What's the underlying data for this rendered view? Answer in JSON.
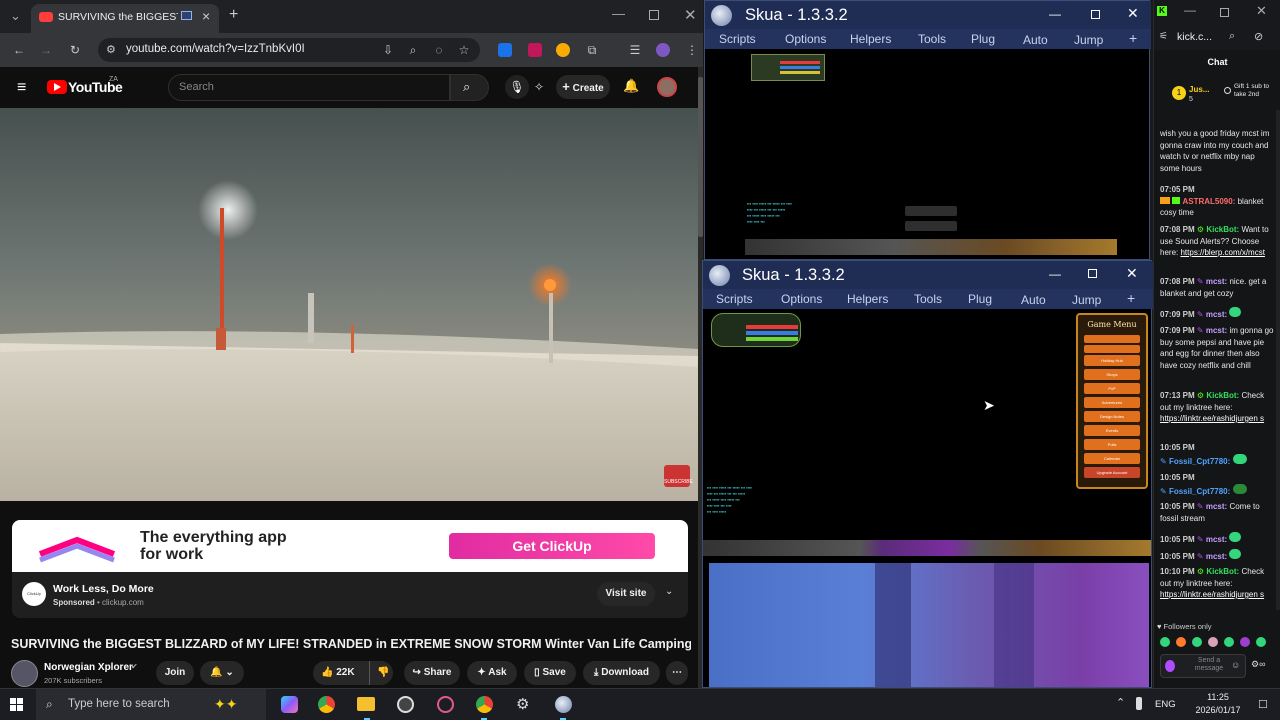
{
  "chrome": {
    "tab_title": "SURVIVING the BIGGEST BL",
    "url": "youtube.com/watch?v=IzzTnbKvI0I",
    "new_tab_label": "+"
  },
  "youtube": {
    "logo_text": "YouTube",
    "logo_region": "ZA",
    "search_placeholder": "Search",
    "create_label": "Create",
    "ad": {
      "banner_text_line1": "The everything app",
      "banner_text_line2": "for work",
      "banner_cta": "Get ClickUp",
      "title": "Work Less, Do More",
      "sponsored": "Sponsored",
      "domain": "clickup.com",
      "visit_label": "Visit site",
      "logo_text": "ClickUp"
    },
    "video_title": "SURVIVING the BIGGEST BLIZZARD of MY LIFE! STRANDED in EXTREME SNOW STORM Winter Van Life Camping",
    "channel_name": "Norwegian Xplorer",
    "subscribers": "207K subscribers",
    "join_label": "Join",
    "likes": "22K",
    "share_label": "Share",
    "ask_label": "Ask",
    "save_label": "Save",
    "download_label": "Download",
    "subscribe_badge": "SUBSCRIBE"
  },
  "skua_top": {
    "title": "Skua - 1.3.3.2",
    "menu": [
      "Scripts",
      "Options",
      "Helpers",
      "Tools",
      "Plug",
      "Auto",
      "Jump",
      "+"
    ]
  },
  "skua_bottom": {
    "title": "Skua - 1.3.3.2",
    "menu": [
      "Scripts",
      "Options",
      "Helpers",
      "Tools",
      "Plug",
      "Auto",
      "Jump",
      "+"
    ],
    "game_menu_title": "Game Menu",
    "game_menu_items": [
      "Holiday Hub",
      "Shops",
      "PvP",
      "Adventures",
      "Design Notes",
      "Events",
      "Polls",
      "Calendar",
      "Upgrade Account"
    ]
  },
  "kick": {
    "tab_label": "kick.c...",
    "chat_header": "Chat",
    "pinned_user": "Jus...",
    "pinned_count": "5",
    "gift_text": "Gift 1 sub to take 2nd",
    "messages": [
      {
        "text": "wish you a good friday mcst im gonna craw into my couch and watch tv or netflix mby nap some hours"
      },
      {
        "time": "07:05 PM",
        "user": "ASTRAL5090:",
        "text": "blanket cosy time"
      },
      {
        "time": "07:08 PM",
        "user": "KickBot:",
        "text": "Want to use Sound Alerts?? Choose here:",
        "link": "https://blerp.com/x/mcst"
      },
      {
        "time": "07:08 PM",
        "user": "mcst:",
        "text": "nice. get a blanket and get cozy"
      },
      {
        "time": "07:09 PM",
        "user": "mcst:",
        "text": ""
      },
      {
        "time": "07:09 PM",
        "user": "mcst:",
        "text": "im gonna go buy some pepsi and have pie and egg for dinner then also have cozy netflix and chill"
      },
      {
        "time": "07:13 PM",
        "user": "KickBot:",
        "text": "Check out my linktree here:",
        "link": "https://linktr.ee/rashidjurgen s"
      },
      {
        "time": "10:05 PM",
        "user": "Fossil_Cpt7780:",
        "text": ""
      },
      {
        "time": "10:05 PM",
        "user": "Fossil_Cpt7780:",
        "text": ""
      },
      {
        "time": "10:05 PM",
        "user": "mcst:",
        "text": "Come to fossil stream"
      },
      {
        "time": "10:05 PM",
        "user": "mcst:",
        "text": ""
      },
      {
        "time": "10:05 PM",
        "user": "mcst:",
        "text": ""
      },
      {
        "time": "10:10 PM",
        "user": "KickBot:",
        "text": "Check out my linktree here:",
        "link": "https://linktr.ee/rashidjurgen s"
      }
    ],
    "followers_only": "Followers only",
    "send_placeholder": "Send a message"
  },
  "taskbar": {
    "search_placeholder": "Type here to search",
    "language": "ENG",
    "time": "11:25",
    "date": "2026/01/17"
  },
  "colors": {
    "kick_green": "#53fc18",
    "youtube_red": "#ff0000",
    "skua_title": "#1f2d54"
  }
}
